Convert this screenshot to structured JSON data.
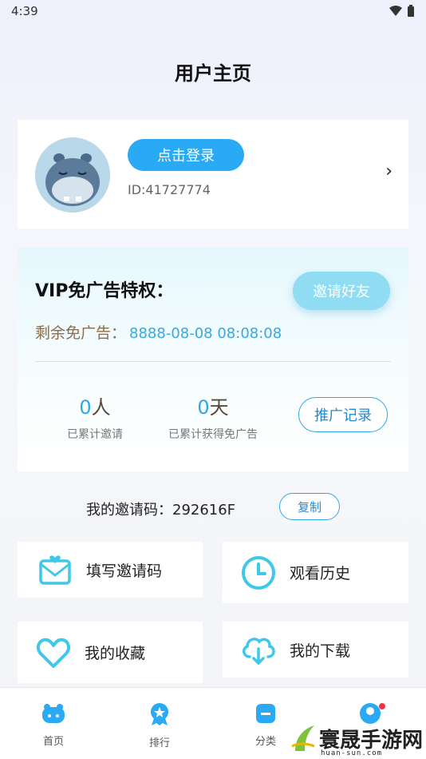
{
  "status_bar": {
    "time": "4:39"
  },
  "page": {
    "title": "用户主页"
  },
  "profile": {
    "login_label": "点击登录",
    "user_id": "ID:41727774"
  },
  "vip": {
    "title": "VIP免广告特权：",
    "invite_label": "邀请好友",
    "remain_label": "剩余免广告：",
    "remain_value": "8888-08-08 08:08:08",
    "stats": [
      {
        "number": "0",
        "unit": "人",
        "label": "已累计邀请"
      },
      {
        "number": "0",
        "unit": "天",
        "label": "已累计获得免广告"
      }
    ],
    "record_label": "推广记录"
  },
  "invite_code": {
    "label": "我的邀请码：292616F",
    "copy_label": "复制"
  },
  "menu": [
    {
      "label": "填写邀请码",
      "icon": "mail-heart-icon"
    },
    {
      "label": "观看历史",
      "icon": "clock-icon"
    },
    {
      "label": "我的收藏",
      "icon": "heart-icon"
    },
    {
      "label": "我的下载",
      "icon": "cloud-download-icon"
    }
  ],
  "bottom_nav": [
    {
      "label": "首页",
      "icon": "hippo-home-icon"
    },
    {
      "label": "排行",
      "icon": "ranking-badge-icon"
    },
    {
      "label": "分类",
      "icon": "category-icon"
    },
    {
      "label": "",
      "icon": "profile-icon"
    }
  ],
  "watermark": {
    "text": "寰晟手游网",
    "sub": "huan-sun.com"
  },
  "colors": {
    "accent": "#2aa9f4",
    "vip_gold": "#8a6d4a",
    "icon_cyan": "#3fc8e8"
  }
}
